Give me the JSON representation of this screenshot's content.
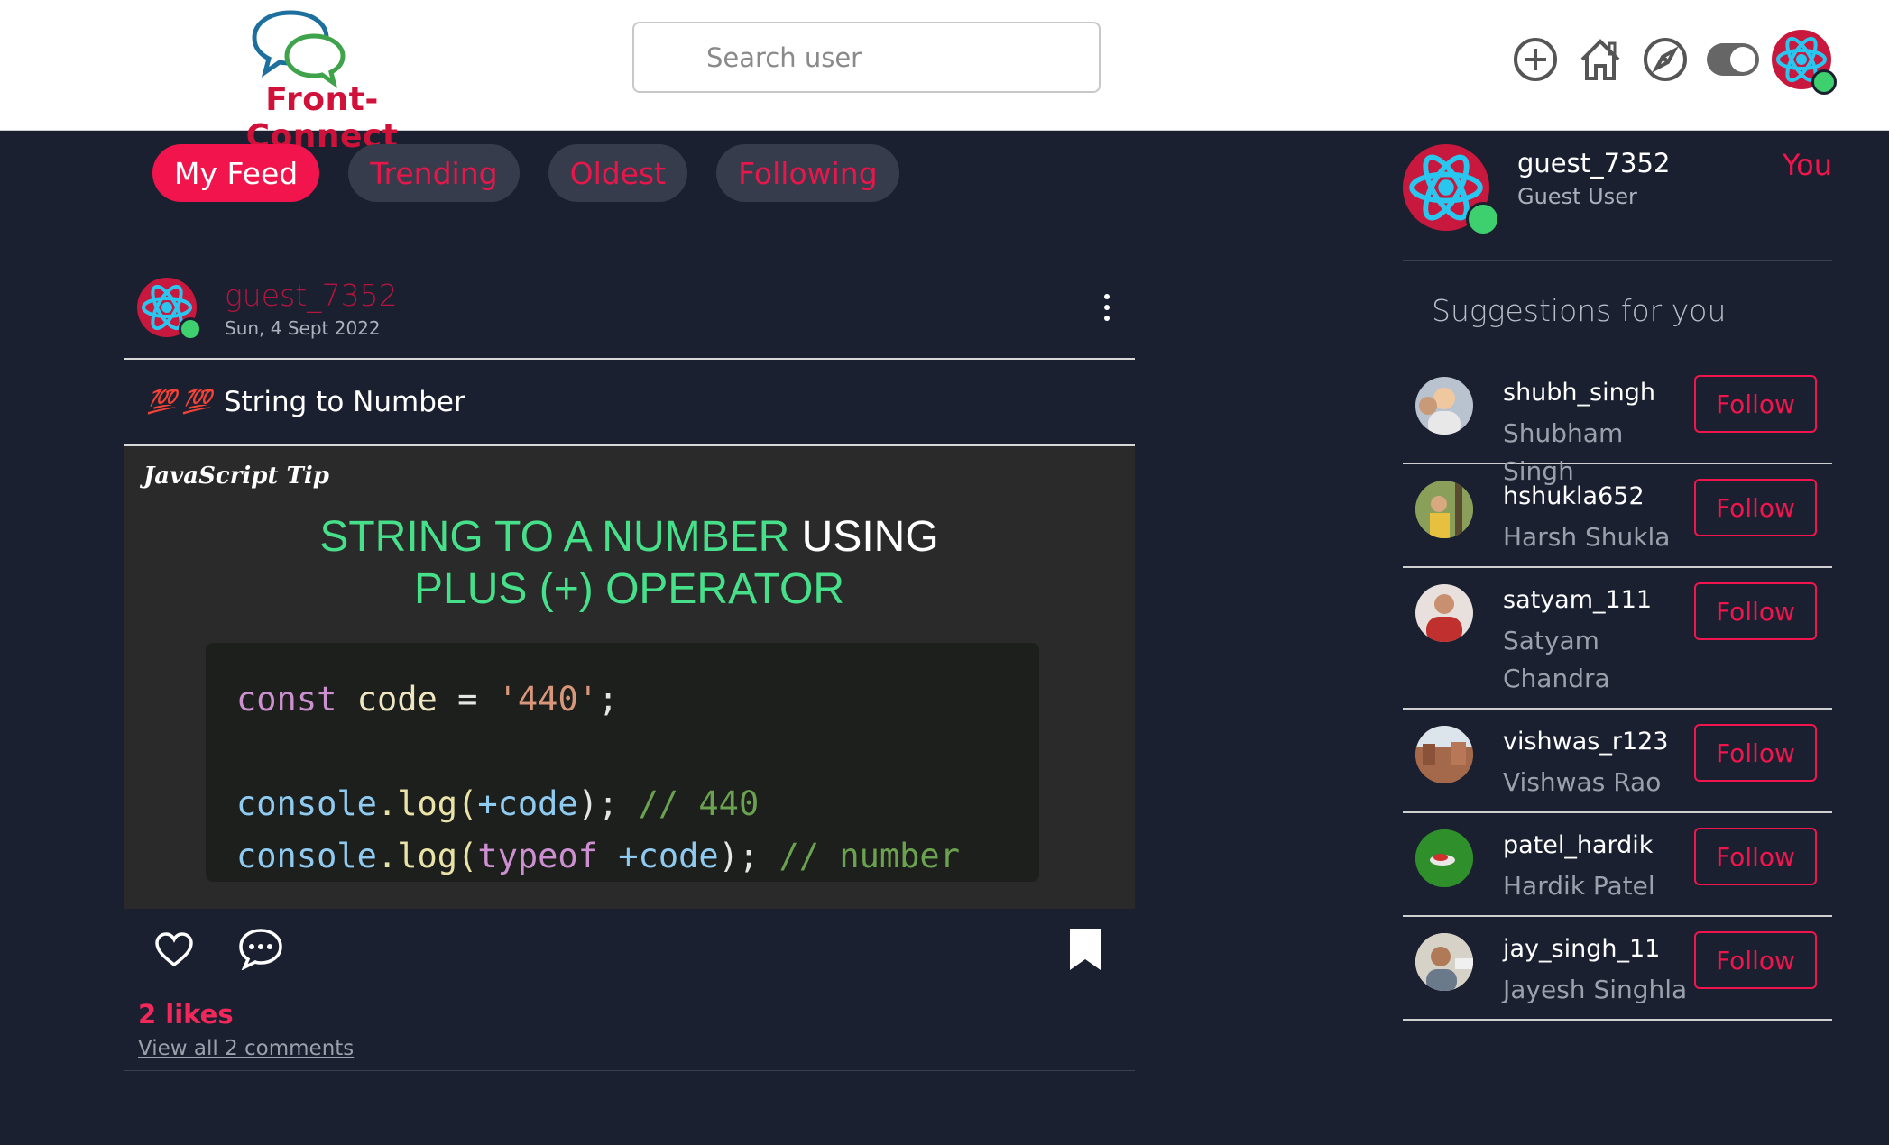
{
  "app": {
    "logo_text": "Front-Connect"
  },
  "header": {
    "search_placeholder": "Search user",
    "icons": [
      "add-post-icon",
      "home-icon",
      "explore-compass-icon",
      "theme-toggle",
      "profile-avatar"
    ]
  },
  "tabs": [
    {
      "label": "My Feed",
      "active": true
    },
    {
      "label": "Trending",
      "active": false
    },
    {
      "label": "Oldest",
      "active": false
    },
    {
      "label": "Following",
      "active": false
    }
  ],
  "post": {
    "username": "guest_7352",
    "date": "Sun, 4 Sept 2022",
    "caption_emoji": "💯 💯",
    "caption": "String to Number",
    "image": {
      "label": "JavaScript Tip",
      "title_green_1": "STRING TO A NUMBER",
      "title_white": "USING",
      "title_green_2": "PLUS (+) OPERATOR",
      "code": {
        "line1_kw": "const",
        "line1_var": "code",
        "line1_eq": "=",
        "line1_str": "'440'",
        "line1_end": ";",
        "line2_obj": "console",
        "line2_fn": ".log(",
        "line2_arg": "+code",
        "line2_end": ");",
        "line2_cm": "// 440",
        "line3_obj": "console",
        "line3_fn": ".log(",
        "line3_kw": "typeof",
        "line3_arg": "+code",
        "line3_end": ");",
        "line3_cm": "// number"
      }
    },
    "likes": "2 likes",
    "view_comments": "View all 2 comments"
  },
  "sidebar": {
    "me": {
      "username": "guest_7352",
      "name": "Guest User",
      "you_label": "You"
    },
    "suggestions_title": "Suggestions for you",
    "follow_label": "Follow",
    "suggestions": [
      {
        "username": "shubh_singh",
        "name": "Shubham Singh",
        "avatar_color": "#b9c3cf"
      },
      {
        "username": "hshukla652",
        "name": "Harsh Shukla",
        "avatar_color": "#7a8b4a"
      },
      {
        "username": "satyam_111",
        "name": "Satyam Chandra",
        "avatar_color": "#c0302e"
      },
      {
        "username": "vishwas_r123",
        "name": "Vishwas Rao",
        "avatar_color": "#a4684a"
      },
      {
        "username": "patel_hardik",
        "name": "Hardik Patel",
        "avatar_color": "#2f8f2a"
      },
      {
        "username": "jay_singh_11",
        "name": "Jayesh Singhla",
        "avatar_color": "#d7d2c8"
      }
    ]
  },
  "colors": {
    "accent": "#f2154d",
    "background": "#1b2030",
    "online": "#3ecf6e"
  }
}
